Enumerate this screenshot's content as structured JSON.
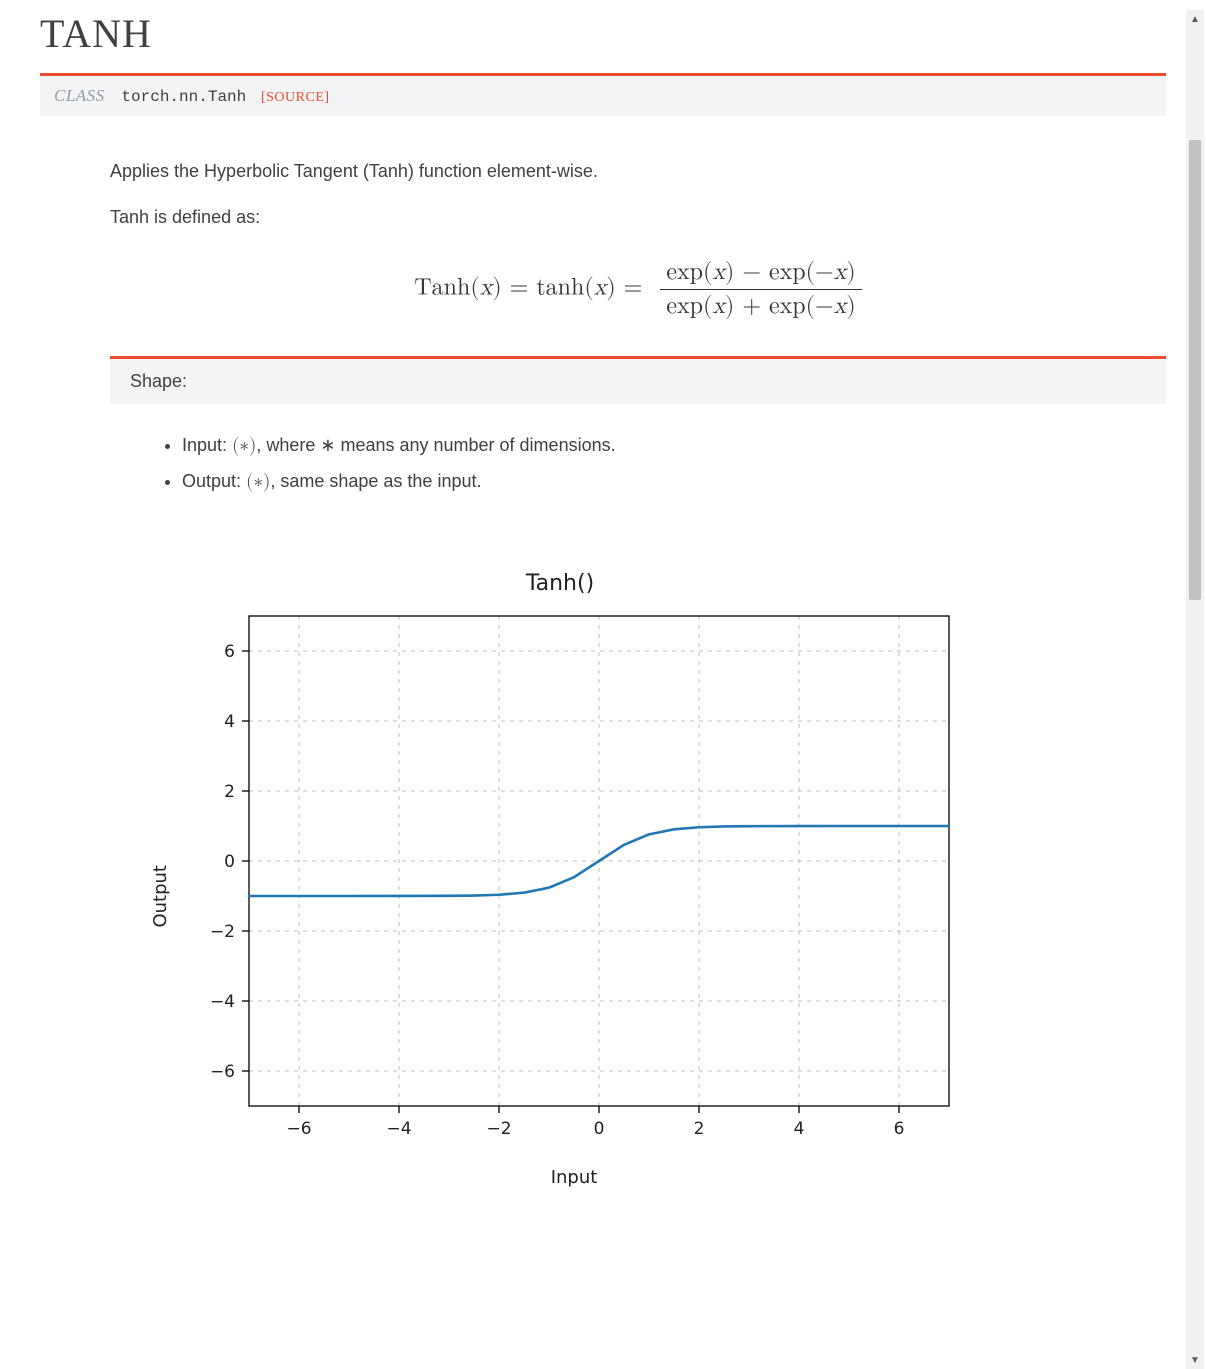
{
  "title": "TANH",
  "signature": {
    "kind": "CLASS",
    "fqn": "torch.nn.Tanh",
    "source_label": "[SOURCE]"
  },
  "description": {
    "line1": "Applies the Hyperbolic Tangent (Tanh) function element-wise.",
    "line2": "Tanh is defined as:"
  },
  "formula": {
    "lhs": "Tanh(x) = tanh(x) =",
    "numerator": "exp(x) − exp(−x)",
    "denominator": "exp(x) + exp(−x)"
  },
  "shape": {
    "header": "Shape:",
    "input_prefix": "Input: ",
    "input_symbol": "(∗)",
    "input_suffix": ", where ∗ means any number of dimensions.",
    "output_prefix": "Output: ",
    "output_symbol": "(∗)",
    "output_suffix": ", same shape as the input."
  },
  "chart_data": {
    "type": "line",
    "title": "Tanh()",
    "xlabel": "Input",
    "ylabel": "Output",
    "xlim": [
      -7,
      7
    ],
    "ylim": [
      -7,
      7
    ],
    "xticks": [
      -6,
      -4,
      -2,
      0,
      2,
      4,
      6
    ],
    "yticks": [
      -6,
      -4,
      -2,
      0,
      2,
      4,
      6
    ],
    "x": [
      -7,
      -6,
      -5,
      -4,
      -3,
      -2.5,
      -2,
      -1.5,
      -1,
      -0.5,
      0,
      0.5,
      1,
      1.5,
      2,
      2.5,
      3,
      4,
      5,
      6,
      7
    ],
    "y": [
      -1.0,
      -1.0,
      -0.9999,
      -0.9993,
      -0.9951,
      -0.9866,
      -0.964,
      -0.9051,
      -0.7616,
      -0.4621,
      0.0,
      0.4621,
      0.7616,
      0.9051,
      0.964,
      0.9866,
      0.9951,
      0.9993,
      0.9999,
      1.0,
      1.0
    ]
  }
}
